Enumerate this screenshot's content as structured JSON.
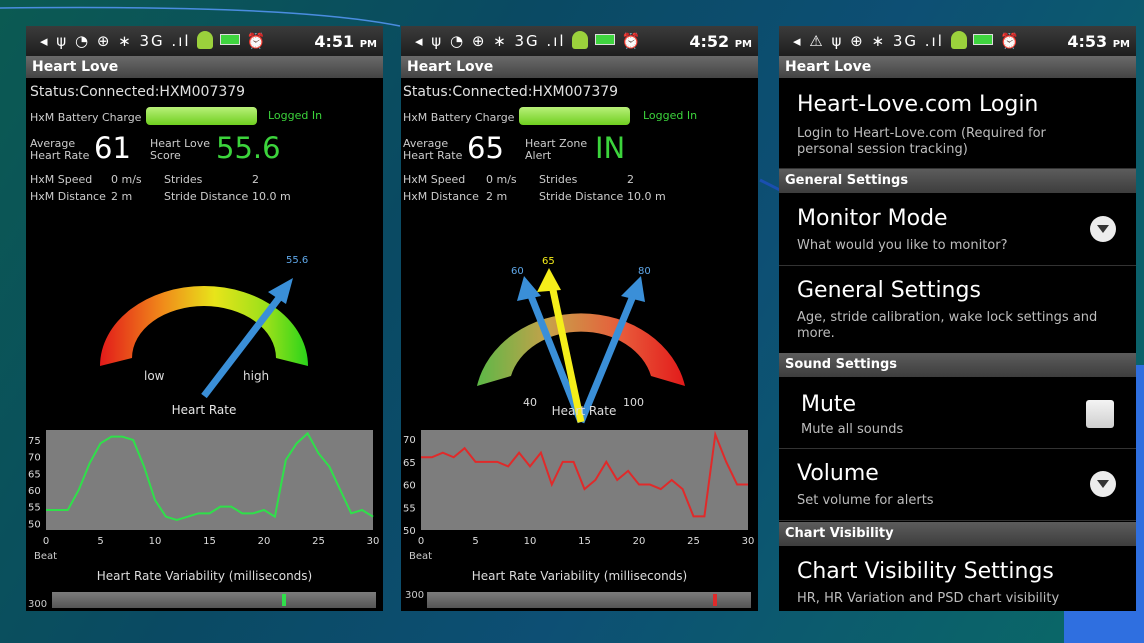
{
  "phone1": {
    "status_icons": "◂ ψ   ◔ ⊕ ∗ 3G .ıl",
    "time": "4:51",
    "ampm": "PM",
    "title": "Heart Love",
    "status": "Status:Connected:HXM007379",
    "battery_label": "HxM Battery Charge",
    "logged_in": "Logged In",
    "avg_label_1": "Average",
    "avg_label_2": "Heart Rate",
    "avg_value": "61",
    "score_label_1": "Heart Love",
    "score_label_2": "Score",
    "score_value": "55.6",
    "speed_label": "HxM Speed",
    "speed_value": "0 m/s",
    "strides_label": "Strides",
    "strides_value": "2",
    "distance_label": "HxM Distance",
    "distance_value": "2 m",
    "stride_dist_label": "Stride Distance",
    "stride_dist_value": "10.0 m",
    "gauge_low": "low",
    "gauge_high": "high",
    "gauge_value_label": "55.6",
    "gauge_caption": "Heart Rate",
    "chart_xlabel": "Beat",
    "chart_caption": "Heart Rate Variability (milliseconds)",
    "scroll_label": "300"
  },
  "phone2": {
    "status_icons": "◂ ψ   ◔ ⊕ ∗ 3G .ıl",
    "time": "4:52",
    "ampm": "PM",
    "title": "Heart Love",
    "status": "Status:Connected:HXM007379",
    "battery_label": "HxM Battery Charge",
    "logged_in": "Logged In",
    "avg_label_1": "Average",
    "avg_label_2": "Heart Rate",
    "avg_value": "65",
    "zone_label_1": "Heart Zone",
    "zone_label_2": "Alert",
    "zone_value": "IN",
    "speed_label": "HxM Speed",
    "speed_value": "0 m/s",
    "strides_label": "Strides",
    "strides_value": "2",
    "distance_label": "HxM Distance",
    "distance_value": "2 m",
    "stride_dist_label": "Stride Distance",
    "stride_dist_value": "10.0 m",
    "needle_labels": [
      "60",
      "65",
      "80"
    ],
    "gauge_min": "40",
    "gauge_max": "100",
    "gauge_caption": "Heart Rate",
    "chart_xlabel": "Beat",
    "chart_caption": "Heart Rate Variability (milliseconds)",
    "scroll_label": "300"
  },
  "phone3": {
    "status_icons": "◂ ⚠ ψ   ⊕ ∗ 3G .ıl",
    "time": "4:53",
    "ampm": "PM",
    "title": "Heart Love",
    "login_title": "Heart-Love.com Login",
    "login_summary_1": "Login to Heart-Love.com (Required for",
    "login_summary_2": "personal session tracking)",
    "cat_general": "General Settings",
    "monitor_title": "Monitor Mode",
    "monitor_summary": "What would you like to monitor?",
    "general_title": "General Settings",
    "general_summary_1": "Age, stride calibration, wake lock settings and",
    "general_summary_2": "more.",
    "cat_sound": "Sound Settings",
    "mute_title": "Mute",
    "mute_summary": "Mute all sounds",
    "volume_title": "Volume",
    "volume_summary": "Set volume for alerts",
    "cat_chart": "Chart Visibility",
    "chartvis_title": "Chart Visibility Settings",
    "chartvis_summary": "HR, HR Variation and PSD chart visibility"
  },
  "colors": {
    "chart1_line": "#2fe04a",
    "chart2_line": "#e02a2a",
    "chart_bg": "#7d7d7d",
    "needle_blue": "#3a8fd8",
    "needle_yellow": "#f5ee1a",
    "score_green": "#3cd43c"
  },
  "chart_data": [
    {
      "type": "line",
      "x": [
        0,
        1,
        2,
        3,
        4,
        5,
        6,
        7,
        8,
        9,
        10,
        11,
        12,
        13,
        14,
        15,
        16,
        17,
        18,
        19,
        20,
        21,
        22,
        23,
        24,
        25,
        26,
        27,
        28,
        29,
        30
      ],
      "values": [
        54,
        54,
        54,
        60,
        68,
        74,
        76,
        76,
        75,
        67,
        57,
        52,
        51,
        52,
        53,
        53,
        55,
        55,
        53,
        53,
        54,
        52,
        69,
        74,
        77,
        71,
        67,
        60,
        53,
        54,
        52
      ],
      "xlabel": "Beat",
      "title": "Heart Rate Variability (milliseconds)",
      "xticks": [
        0,
        5,
        10,
        15,
        20,
        25,
        30
      ],
      "yticks": [
        50,
        55,
        60,
        65,
        70,
        75
      ],
      "xlim": [
        0,
        30
      ],
      "ylim": [
        48,
        78
      ]
    },
    {
      "type": "line",
      "x": [
        0,
        1,
        2,
        3,
        4,
        5,
        6,
        7,
        8,
        9,
        10,
        11,
        12,
        13,
        14,
        15,
        16,
        17,
        18,
        19,
        20,
        21,
        22,
        23,
        24,
        25,
        26,
        27,
        28,
        29,
        30
      ],
      "values": [
        66,
        66,
        67,
        66,
        68,
        65,
        65,
        65,
        64,
        67,
        64,
        67,
        60,
        65,
        65,
        59,
        61,
        65,
        61,
        63,
        60,
        60,
        59,
        61,
        59,
        53,
        53,
        71,
        65,
        60,
        60
      ],
      "xlabel": "Beat",
      "title": "Heart Rate Variability (milliseconds)",
      "xticks": [
        0,
        5,
        10,
        15,
        20,
        25,
        30
      ],
      "yticks": [
        50,
        55,
        60,
        65,
        70
      ],
      "xlim": [
        0,
        30
      ],
      "ylim": [
        50,
        72
      ]
    }
  ]
}
